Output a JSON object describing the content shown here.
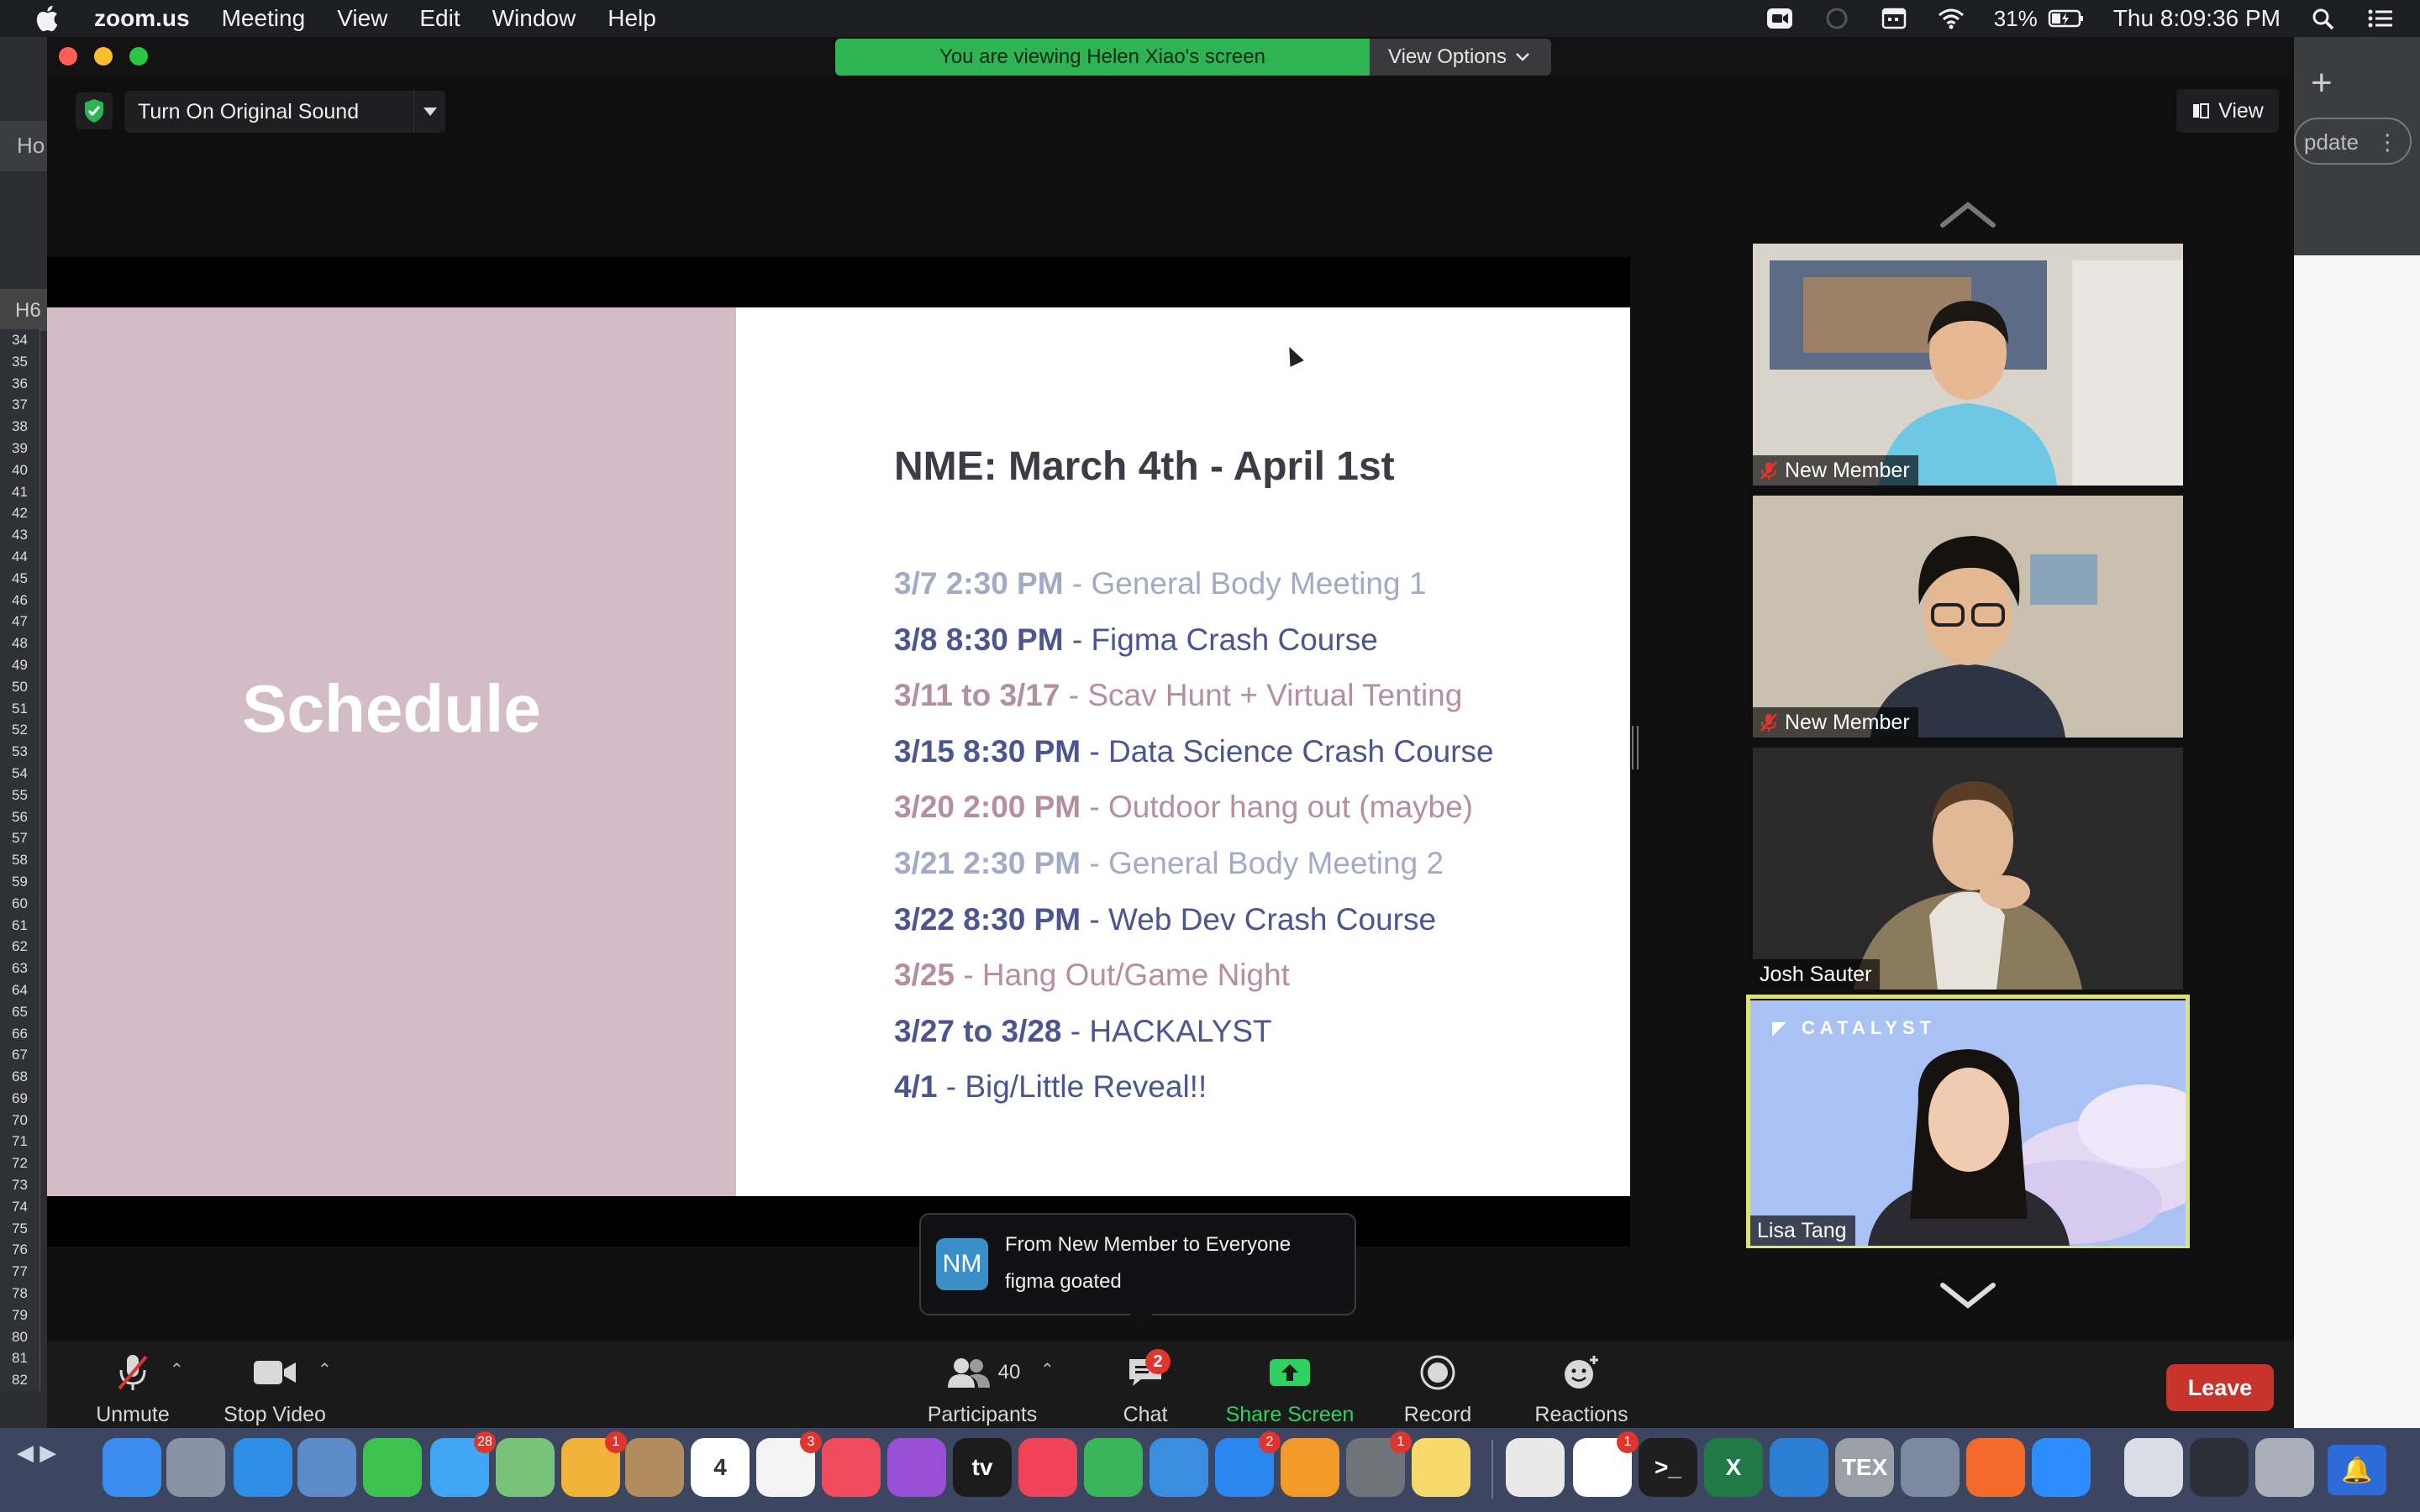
{
  "menubar": {
    "app_name": "zoom.us",
    "menus": [
      "Meeting",
      "View",
      "Edit",
      "Window",
      "Help"
    ],
    "battery": "31%",
    "clock": "Thu 8:09:36 PM"
  },
  "background_app": {
    "tab_label": "Ho",
    "cell_ref": "H6",
    "update_label": "pdate",
    "row_numbers": [
      "34",
      "35",
      "36",
      "37",
      "38",
      "39",
      "40",
      "41",
      "42",
      "43",
      "44",
      "45",
      "46",
      "47",
      "48",
      "49",
      "50",
      "51",
      "52",
      "53",
      "54",
      "55",
      "56",
      "57",
      "58",
      "59",
      "60",
      "61",
      "62",
      "63",
      "64",
      "65",
      "66",
      "67",
      "68",
      "69",
      "70",
      "71",
      "72",
      "73",
      "74",
      "75",
      "76",
      "77",
      "78",
      "79",
      "80",
      "81",
      "82"
    ]
  },
  "zoom": {
    "viewing_banner": "You are viewing Helen Xiao's screen",
    "view_options_label": "View Options",
    "original_sound_label": "Turn On Original Sound",
    "view_label": "View",
    "slide": {
      "title": "Schedule",
      "heading": "NME: March 4th - April 1st",
      "items": [
        {
          "date": "3/7 2:30 PM",
          "event": " - General Body Meeting 1",
          "tone": "grey"
        },
        {
          "date": "3/8 8:30 PM",
          "event": " - Figma Crash Course",
          "tone": "navy"
        },
        {
          "date": "3/11 to 3/17",
          "event": " - Scav Hunt + Virtual Tenting",
          "tone": "pink"
        },
        {
          "date": "3/15 8:30 PM",
          "event": " - Data Science Crash Course",
          "tone": "navy"
        },
        {
          "date": "3/20 2:00 PM",
          "event": " - Outdoor hang out (maybe)",
          "tone": "pink"
        },
        {
          "date": "3/21 2:30 PM",
          "event": " - General Body Meeting 2",
          "tone": "grey"
        },
        {
          "date": "3/22 8:30 PM",
          "event": " - Web Dev Crash Course",
          "tone": "navy"
        },
        {
          "date": "3/25",
          "event": " - Hang Out/Game Night",
          "tone": "pink"
        },
        {
          "date": "3/27 to 3/28",
          "event": " - HACKALYST",
          "tone": "navy"
        },
        {
          "date": "4/1",
          "event": " - Big/Little Reveal!!",
          "tone": "navy"
        }
      ]
    },
    "participants": [
      {
        "name": "New Member",
        "muted": true
      },
      {
        "name": "New Member",
        "muted": true
      },
      {
        "name": "Josh Sauter",
        "muted": false
      },
      {
        "name": "Lisa Tang",
        "muted": false,
        "background_text": "CATALYST",
        "active_speaker": true
      }
    ],
    "chat_toast": {
      "initials": "NM",
      "from": "From New Member to Everyone",
      "message": "figma goated"
    },
    "controls": {
      "unmute": "Unmute",
      "stop_video": "Stop Video",
      "participants": "Participants",
      "participants_count": "40",
      "chat": "Chat",
      "chat_badge": "2",
      "share_screen": "Share Screen",
      "record": "Record",
      "reactions": "Reactions",
      "leave": "Leave"
    }
  },
  "dock": {
    "apps": [
      {
        "name": "Finder",
        "color": "#3b8df0"
      },
      {
        "name": "Launchpad",
        "color": "#8a93a6"
      },
      {
        "name": "Safari",
        "color": "#2f8ee6"
      },
      {
        "name": "Preview",
        "color": "#5b8cc9"
      },
      {
        "name": "FaceTime",
        "color": "#3ec24f"
      },
      {
        "name": "Messages",
        "color": "#3fa6f5",
        "badge": "28"
      },
      {
        "name": "Maps",
        "color": "#79c27a"
      },
      {
        "name": "Photos",
        "color": "#f0b43a",
        "badge": "1"
      },
      {
        "name": "Contacts",
        "color": "#b28b5e"
      },
      {
        "name": "Calendar",
        "color": "#ffffff",
        "text": "4"
      },
      {
        "name": "Reminders",
        "color": "#f3f3f3",
        "badge": "3"
      },
      {
        "name": "Music",
        "color": "#f14b5e"
      },
      {
        "name": "Podcasts",
        "color": "#9a4fd8"
      },
      {
        "name": "TV",
        "color": "#1b1b1b",
        "text": "tv"
      },
      {
        "name": "News",
        "color": "#f0435a"
      },
      {
        "name": "Numbers",
        "color": "#3bb55a"
      },
      {
        "name": "Keynote",
        "color": "#3a8de0"
      },
      {
        "name": "App Store",
        "color": "#2a86f0",
        "badge": "2"
      },
      {
        "name": "Pages",
        "color": "#f29b2b"
      },
      {
        "name": "System Preferences",
        "color": "#6f737a",
        "badge": "1"
      },
      {
        "name": "Notes",
        "color": "#f7d86b"
      },
      {
        "name": "Chrome",
        "color": "#e9e9e9"
      },
      {
        "name": "Slack",
        "color": "#ffffff",
        "badge": "1"
      },
      {
        "name": "Terminal",
        "color": "#1f1f1f",
        "text": ">_"
      },
      {
        "name": "Excel",
        "color": "#1f7a45",
        "text": "X"
      },
      {
        "name": "VS Code",
        "color": "#2a7fd4"
      },
      {
        "name": "TeX",
        "color": "#9aa0a8",
        "text": "TEX"
      },
      {
        "name": "Image Capture",
        "color": "#7c8aa0"
      },
      {
        "name": "Firefox",
        "color": "#f36a2a"
      },
      {
        "name": "Zoom",
        "color": "#2d8cff"
      },
      {
        "name": "Document",
        "color": "#d8dde6"
      },
      {
        "name": "Screen",
        "color": "#2b2f38"
      },
      {
        "name": "Trash",
        "color": "#aab0ba"
      }
    ]
  }
}
